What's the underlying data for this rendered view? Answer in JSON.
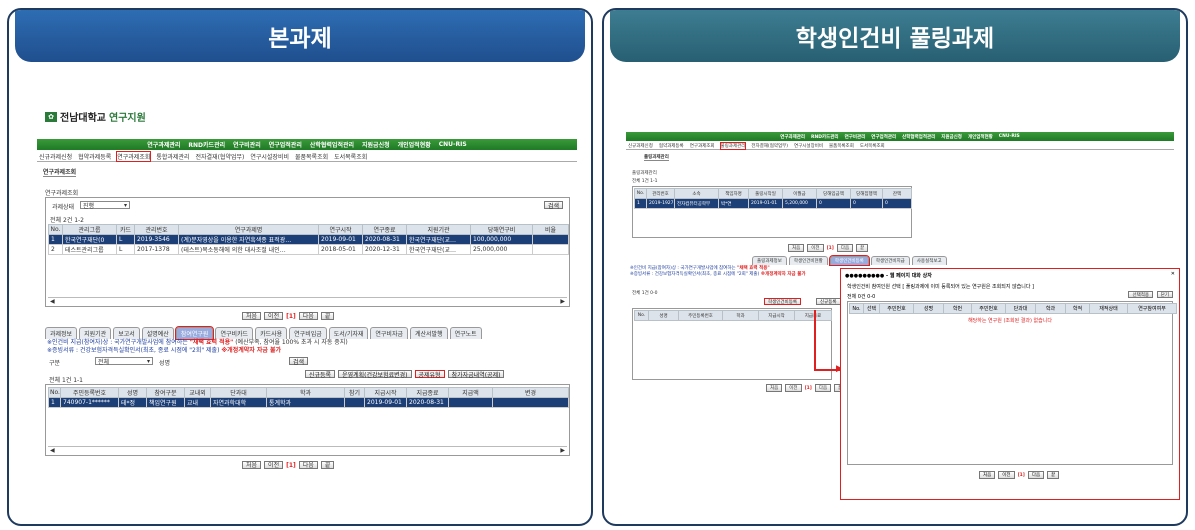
{
  "left": {
    "header": "본과제",
    "logo": {
      "name": "전남대학교",
      "sub": "연구지원"
    },
    "gnav": [
      "연구과제관리",
      "RND카드관리",
      "연구비관리",
      "연구업적관리",
      "산학협력업적관리",
      "지원금신청",
      "개인업적현황",
      "CNU-RIS"
    ],
    "snav": [
      "신규과제신청",
      "협약과제등록",
      "연구과제조회",
      "통합과제관리",
      "전자결재(협약업무)",
      "연구시설장비비",
      "물품목록조회",
      "도서목록조회"
    ],
    "snav_active": 2,
    "page_tab": "연구과제조회",
    "section_label": "연구과제조회",
    "filter": {
      "label": "과제상태",
      "value": "진행",
      "search": "검색"
    },
    "count": "전체 2건 1-2",
    "table": {
      "headers": [
        "No.",
        "관리그룹",
        "카드",
        "관리번호",
        "연구과제명",
        "연구시작",
        "연구종료",
        "지원기관",
        "당해연구비",
        "비율"
      ],
      "rows": [
        [
          "1",
          "한국연구재단(0",
          "L",
          "2019-3546",
          "(계)분자영상을 이용한 자연흑색종 표적광…",
          "2019-09-01",
          "2020-08-31",
          "한국연구재단(교…",
          "100,000,000",
          ""
        ],
        [
          "2",
          "테스트관리그룹",
          "L",
          "2017-1378",
          "(테스트)목소동해에 의한 대사조절 내인…",
          "2018-05-01",
          "2020-12-31",
          "한국연구재단(교…",
          "25,000,000",
          ""
        ]
      ]
    },
    "pager": {
      "first": "처음",
      "prev": "이전",
      "current": "[1]",
      "next": "다음",
      "last": "끝"
    },
    "tabs": [
      "과제정보",
      "지원기관",
      "보고서",
      "설명예산",
      "참여연구원",
      "연구비카드",
      "카드사용",
      "연구비입금",
      "도서/기자재",
      "연구비자금",
      "계산서발행",
      "연구노트"
    ],
    "tabs_active": 4,
    "notes": {
      "line1_a": "※인건비 지급(참여자)상 : 국가연구개발사업에 참여하는",
      "line1_b": "\"채택 효력 적용\"",
      "line1_c": "(예산부족, 참여율 100% 초과 시 자동 중지)",
      "line2_a": "※증빙서류 : 건강보험자격득실확인서(최초, 종료 시점에 \"2회\" 제출)",
      "line2_b": "※개정계약자 자금 불가"
    },
    "sub_filter": {
      "label": "구분",
      "value": "전체",
      "label2": "성명",
      "search": "검색"
    },
    "buttons": [
      "신규등록",
      "운영계획(건강보험료변경)",
      "공제유형",
      "참가자금내역(공제)"
    ],
    "count2": "전체 1건 1-1",
    "table2": {
      "headers": [
        "No.",
        "주민등록번호",
        "성명",
        "참여구분",
        "교내외",
        "단과대",
        "학과",
        "참기",
        "지급시작",
        "지급종료",
        "지급액",
        "변경"
      ],
      "rows": [
        [
          "1",
          "740907-1******",
          "테*정",
          "책임연구원",
          "교내",
          "자연과학대학",
          "통계학과",
          "",
          "2019-09-01",
          "2020-08-31",
          "",
          ""
        ]
      ]
    }
  },
  "right": {
    "header": "학생인건비 풀링과제",
    "gnav": [
      "연구과제관리",
      "RND카드관리",
      "연구비관리",
      "연구업적관리",
      "산학협력업적관리",
      "지원금신청",
      "개인업적현황",
      "CNU-RIS"
    ],
    "snav": [
      "신규과제신청",
      "협약과제등록",
      "연구과제조회",
      "풀링과제관리",
      "전자결재(협약업무)",
      "연구시설장비비",
      "물품목록조회",
      "도서목록조회"
    ],
    "snav_active": 3,
    "page_tab": "풀링과제관리",
    "section_label": "풀링과제관리",
    "count": "전체 1건 1-1",
    "table": {
      "headers": [
        "No.",
        "관리번호",
        "소속",
        "책임자명",
        "풀링시작일",
        "이월금",
        "당해입금액",
        "당해집행액",
        "잔액"
      ],
      "rows": [
        [
          "1",
          "2019-1927",
          "전자컴퓨터공학부",
          "박*연",
          "2019-01-01",
          "5,200,000",
          "0",
          "0",
          "0"
        ]
      ]
    },
    "pager": {
      "first": "처음",
      "prev": "이전",
      "current": "[1]",
      "next": "다음",
      "last": "끝"
    },
    "tabs": [
      "풀링과제정보",
      "학생인건비현황",
      "학생인건비등록",
      "학생인건비지급",
      "사용실적보고"
    ],
    "tabs_active": 2,
    "count2": "전체 1건 0-0",
    "btn_register": "학생인건비등록",
    "btn_other": "신규등록",
    "table2": {
      "headers": [
        "No.",
        "성명",
        "주민등록번호",
        "학과",
        "지급시작",
        "지급종료"
      ]
    },
    "modal": {
      "title": "●●●●●●●●● - 웹 페이지 대화 상자",
      "note": "학생인건비 참여인원 선택 [ 풀링과제에 이미 등록되어 있는 연구원은 조회되지 않습니다 ]",
      "count": "전체 0건 0-0",
      "btn_select": "선택적용",
      "btn_close": "닫기",
      "headers": [
        "No.",
        "선택",
        "주민번호",
        "성명",
        "학번",
        "주민번호",
        "단과대",
        "학과",
        "학적",
        "재적상태",
        "연구참여여부"
      ],
      "empty": "해당하는 연구원 (조회된 결과) 없습니다"
    }
  }
}
